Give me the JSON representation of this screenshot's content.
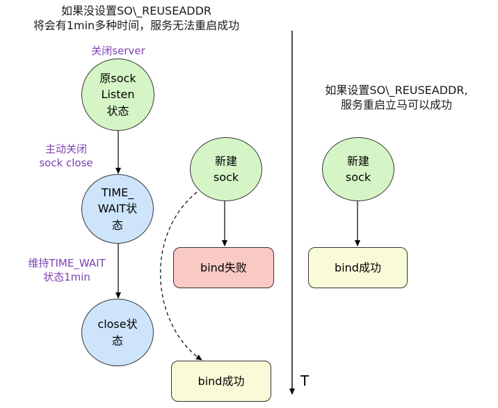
{
  "left_note": [
    "如果没设置SO\\_REUSEADDR",
    "将会有1min多种时间，服务无法重启成功"
  ],
  "right_note": [
    "如果设置SO\\_REUSEADDR,",
    "服务重启立马可以成功"
  ],
  "labels": {
    "close_server": "关闭server",
    "active_close": [
      "主动关闭",
      "sock close"
    ],
    "keep_time_wait": [
      "维持TIME_WAIT",
      "状态1min"
    ]
  },
  "nodes": {
    "orig_sock": [
      "原sock",
      "Listen",
      "状态"
    ],
    "time_wait": [
      "TIME_",
      "WAIT状",
      "态"
    ],
    "close_state": [
      "close状",
      "态"
    ],
    "new_sock_left": [
      "新建",
      "sock"
    ],
    "bind_fail": "bind失败",
    "bind_success_bottom": "bind成功",
    "new_sock_right": [
      "新建",
      "sock"
    ],
    "bind_success_right": "bind成功"
  },
  "time_axis_label": "T",
  "colors": {
    "green": "#d6f5c7",
    "blue": "#cde4fb",
    "red": "#f9c9c3",
    "yellow": "#f9fbd8",
    "purple": "#7b3fb2"
  }
}
